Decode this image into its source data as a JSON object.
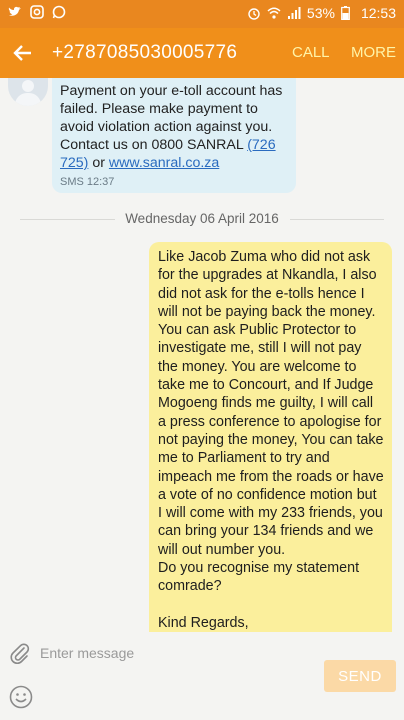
{
  "status_bar": {
    "battery": "53%",
    "time": "12:53",
    "icons": [
      "twitter-icon",
      "instagram-icon",
      "whatsapp-icon",
      "alarm-icon",
      "wifi-icon",
      "signal-icon",
      "battery-icon"
    ]
  },
  "app_bar": {
    "contact": "+2787085030005776",
    "call_label": "CALL",
    "more_label": "MORE",
    "accent": "#f08f1a"
  },
  "messages": {
    "incoming": {
      "text_before": "Payment on your e-toll account has failed. Please make payment to avoid violation action against you. Contact us on 0800 SANRAL ",
      "phone_link": "(726 725)",
      "text_mid": " or ",
      "web_link": "www.sanral.co.za",
      "time": "SMS 12:37"
    },
    "date_separator": "Wednesday 06 April 2016",
    "outgoing": {
      "text": "Like Jacob Zuma who did not ask for the upgrades at Nkandla,  I also did not ask for the e-tolls hence I will not be paying back the money. You can ask Public Protector to investigate me, still I will not pay the money. You are welcome to take me to Concourt, and If Judge Mogoeng finds me guilty, I will call a press conference to apologise for not paying the money,  You can take me to Parliament to try and impeach me from the roads or have a vote of no confidence motion but I will come with my 233 friends,  you can bring your 134 friends and we will out number you.\nDo you recognise my statement comrade?\n\nKind Regards,\nFloyd Nkuna"
    }
  },
  "compose": {
    "placeholder": "Enter message",
    "send_label": "SEND"
  }
}
